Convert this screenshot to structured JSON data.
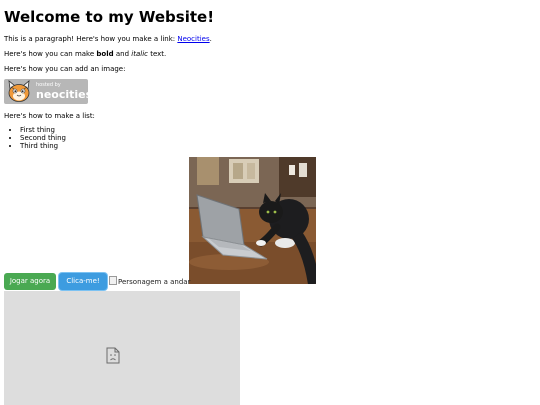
{
  "heading": "Welcome to my Website!",
  "para1": {
    "before": "This is a paragraph! Here's how you make a link: ",
    "link": "Neocities",
    "after": "."
  },
  "para2": {
    "before": "Here's how you can make ",
    "bold": "bold",
    "mid": " and ",
    "italic": "italic",
    "after": " text."
  },
  "para3": "Here's how you can add an image:",
  "badge": {
    "hosted": "hosted by",
    "brand": "neocities"
  },
  "para4": "Here's how to make a list:",
  "list": [
    "First thing",
    "Second thing",
    "Third thing"
  ],
  "buttons": {
    "play": "Jogar agora",
    "click": "Clica-me!"
  },
  "broken_image_alt": "Personagem a andar",
  "colors": {
    "link": "#0000ee",
    "button_green": "#4aa952",
    "button_blue": "#3d9ce0",
    "badge_bg": "#b7b7b7",
    "frame_bg": "#dddddd"
  }
}
